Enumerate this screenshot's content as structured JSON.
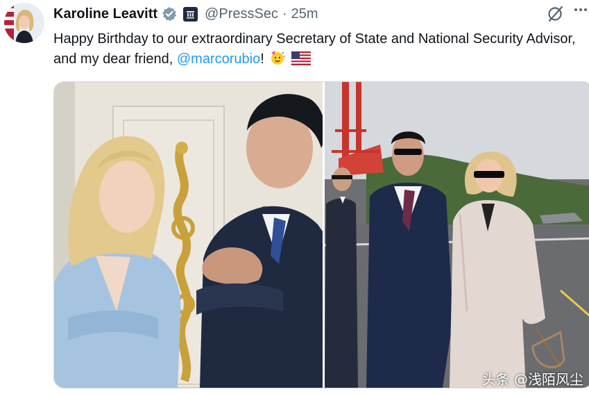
{
  "author": {
    "name": "Karoline Leavitt",
    "handle": "@PressSec",
    "separator": "·",
    "time": "25m",
    "verified_color": "#829aab",
    "icons": [
      "verified-badge-icon",
      "affiliation-badge-icon",
      "grok-icon",
      "more-icon"
    ]
  },
  "tweet": {
    "text_before": "Happy Birthday to our extraordinary Secretary of State and National Security Advisor, and my dear friend, ",
    "mention": "@marcorubio",
    "text_after": "!",
    "emoji": [
      "party-face-emoji",
      "us-flag-emoji"
    ]
  },
  "media": {
    "photos": [
      "photo-rubio-leavitt-indoor",
      "photo-rubio-leavitt-carrier-deck"
    ]
  },
  "watermark": "头条 @浅陌风尘",
  "colors": {
    "link": "#1d9bf0",
    "secondary_text": "#536471",
    "border": "#cfd9de"
  }
}
